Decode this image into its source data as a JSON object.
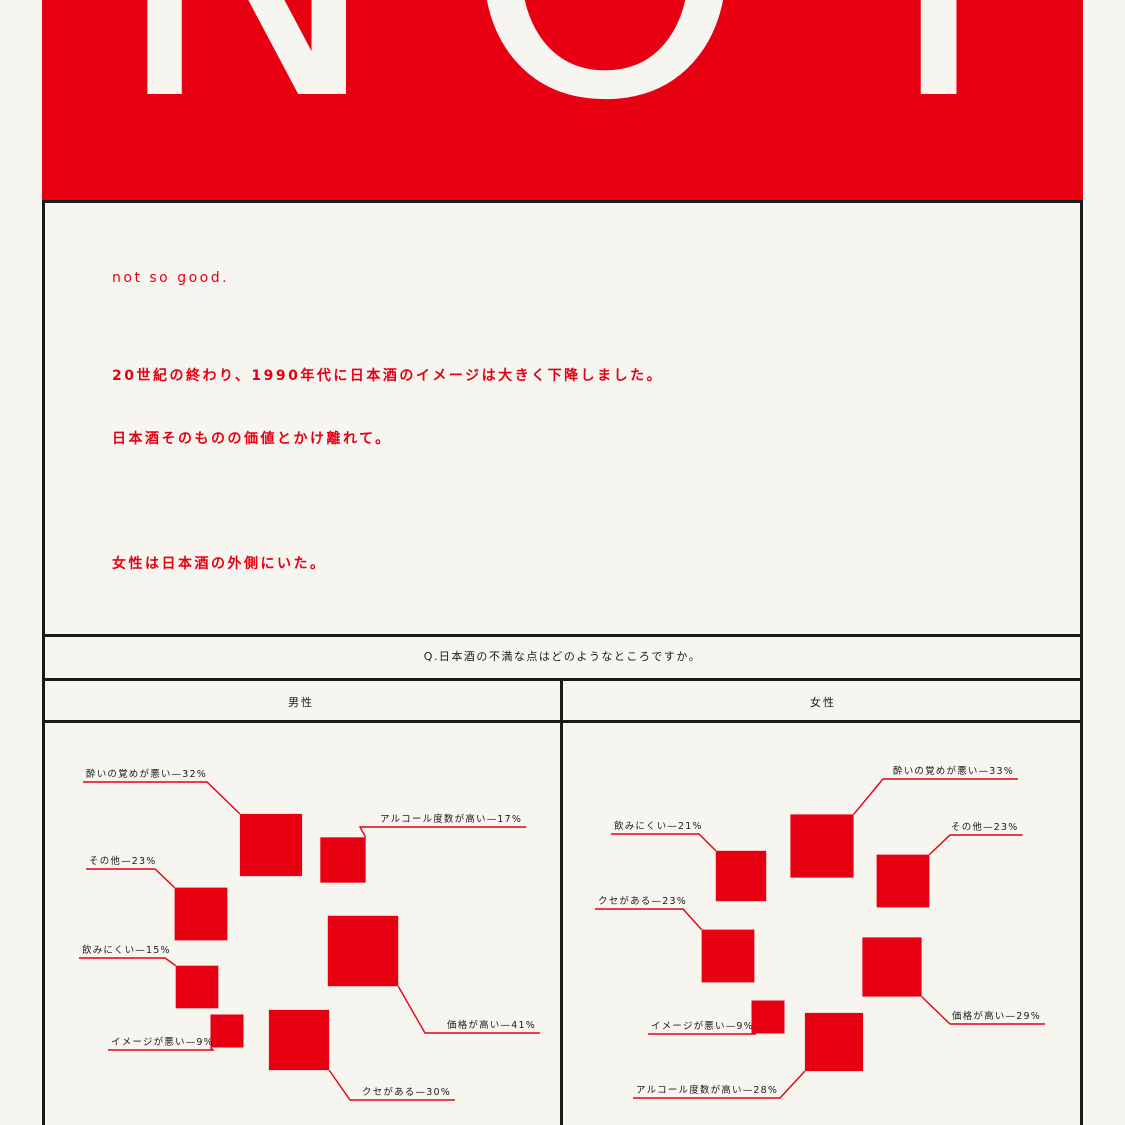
{
  "hero": {
    "word": "NOT"
  },
  "intro": {
    "lead": "not so good.",
    "line1": "20世紀の終わり、1990年代に日本酒のイメージは大きく下降しました。",
    "line2": "日本酒そのものの価値とかけ離れて。",
    "line3": "女性は日本酒の外側にいた。"
  },
  "question": "Q.日本酒の不満な点はどのようなところですか。",
  "colors": {
    "accent": "#e60012",
    "ink": "#1a1a1a",
    "paper": "#f6f5f0"
  },
  "chart_data": [
    {
      "type": "area-squares",
      "title": "男性",
      "items": [
        {
          "label": "酔いの覚めが悪い—32%",
          "value": 32
        },
        {
          "label": "アルコール度数が高い—17%",
          "value": 17
        },
        {
          "label": "その他—23%",
          "value": 23
        },
        {
          "label": "価格が高い—41%",
          "value": 41
        },
        {
          "label": "飲みにくい—15%",
          "value": 15
        },
        {
          "label": "イメージが悪い—9%",
          "value": 9
        },
        {
          "label": "クセがある—30%",
          "value": 30
        }
      ]
    },
    {
      "type": "area-squares",
      "title": "女性",
      "items": [
        {
          "label": "酔いの覚めが悪い—33%",
          "value": 33
        },
        {
          "label": "飲みにくい—21%",
          "value": 21
        },
        {
          "label": "その他—23%",
          "value": 23
        },
        {
          "label": "クセがある—23%",
          "value": 23
        },
        {
          "label": "価格が高い—29%",
          "value": 29
        },
        {
          "label": "イメージが悪い—9%",
          "value": 9
        },
        {
          "label": "アルコール度数が高い—28%",
          "value": 28
        }
      ]
    }
  ]
}
